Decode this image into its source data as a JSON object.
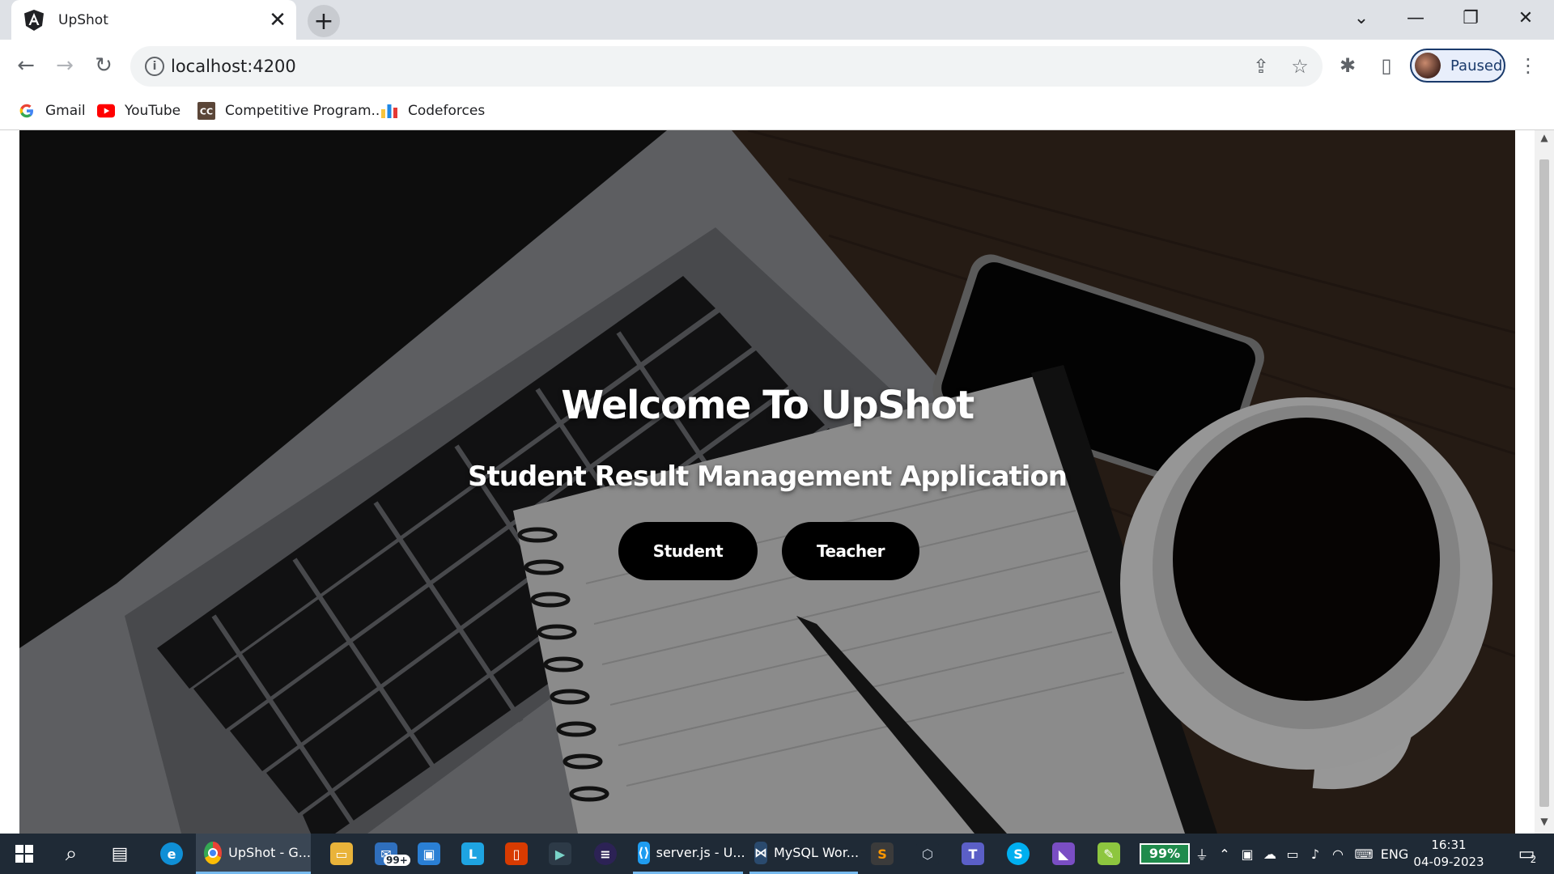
{
  "browser": {
    "tab": {
      "title": "UpShot",
      "favicon": "angular-icon"
    },
    "address_bar": {
      "url": "localhost:4200"
    },
    "profile": {
      "label": "Paused"
    },
    "bookmarks": [
      {
        "label": "Gmail",
        "icon": "google-icon"
      },
      {
        "label": "YouTube",
        "icon": "youtube-icon"
      },
      {
        "label": "Competitive Program...",
        "icon": "codechef-icon"
      },
      {
        "label": "Codeforces",
        "icon": "codeforces-icon"
      }
    ]
  },
  "page": {
    "title": "Welcome To UpShot",
    "subtitle": "Student Result Management Application",
    "buttons": {
      "student": "Student",
      "teacher": "Teacher"
    }
  },
  "taskbar": {
    "apps": [
      {
        "label": "UpShot - G...",
        "icon": "chrome-icon",
        "state": "active"
      },
      {
        "label": "server.js - U...",
        "icon": "vscode-icon",
        "state": "running"
      },
      {
        "label": "MySQL Wor...",
        "icon": "mysql-workbench-icon",
        "state": "running"
      }
    ],
    "mail_badge": "99+",
    "battery": "99%",
    "language": "ENG",
    "time": "16:31",
    "date": "04-09-2023",
    "notifications": "2"
  },
  "colors": {
    "taskbar_bg": "#1f2a36",
    "button_bg": "#000000",
    "battery_bg": "#1f8b4c"
  }
}
